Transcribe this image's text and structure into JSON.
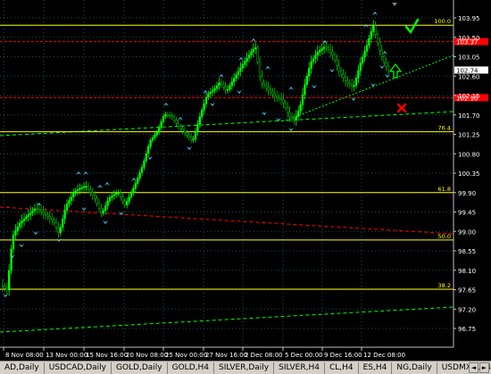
{
  "tabs": [
    "AD,Daily",
    "USDCAD,Daily",
    "GOLD,Daily",
    "GOLD,H4",
    "SILVER,Daily",
    "SILVER,H4",
    "CL,H4",
    "ES,H4",
    "NG,Daily",
    "USDMXN,H4"
  ],
  "tab_scroll_left": "◄",
  "tab_scroll_right": "►",
  "price_labels": [
    "103.95",
    "103.50",
    "103.05",
    "102.60",
    "102.15",
    "101.70",
    "101.25",
    "100.80",
    "100.35",
    "99.90",
    "99.45",
    "99.00",
    "98.55",
    "98.10",
    "97.65",
    "97.20",
    "96.75"
  ],
  "time_labels": [
    "8 Nov 08:00",
    "13 Nov 00:00",
    "15 Nov 16:00",
    "20 Nov 08:00",
    "25 Nov 00:00",
    "27 Nov 16:00",
    "2 Dec 08:00",
    "5 Dec 00:00",
    "9 Dec 16:00",
    "12 Dec 08:00"
  ],
  "fib_levels": [
    {
      "label": "100.0",
      "price": 103.78,
      "color": "#ffff00"
    },
    {
      "label": "76.4",
      "price": 101.31,
      "color": "#ffff00"
    },
    {
      "label": "61.8",
      "price": 99.9,
      "color": "#ffff00"
    },
    {
      "label": "50.0",
      "price": 98.8,
      "color": "#ffff00"
    },
    {
      "label": "38.2",
      "price": 97.66,
      "color": "#ffff00"
    }
  ],
  "red_levels": [
    {
      "label": "103.37",
      "price": 103.4,
      "color": "#ff0000"
    },
    {
      "label": "102.10",
      "price": 102.1,
      "color": "#ff0000"
    }
  ],
  "current_price": "102.74",
  "colors": {
    "bull": "#00ff00",
    "bear": "#00c000",
    "grid": "#1f4f4f",
    "arrow": "#3ec8ff",
    "check": "#00ff00",
    "cross": "#ff0000"
  },
  "icons": [
    "check-icon",
    "cross-icon",
    "up-arrow-icon",
    "fractal-arrow-icon"
  ]
}
